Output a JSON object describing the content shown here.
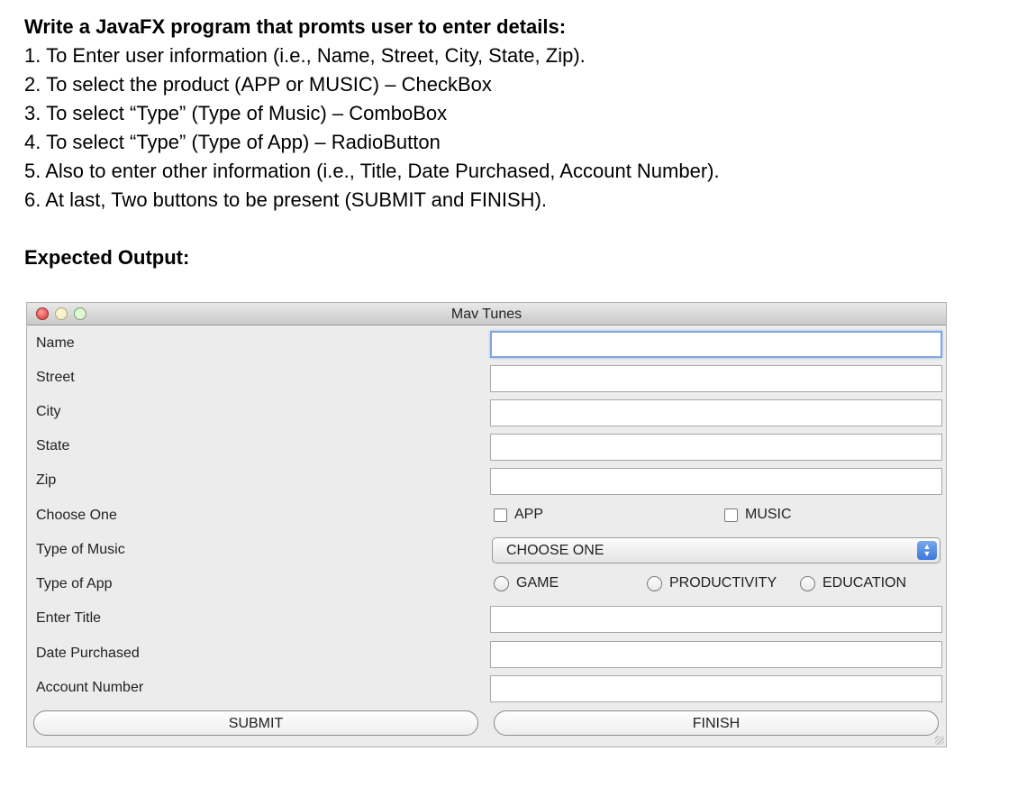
{
  "instructions": {
    "heading": "Write a JavaFX program that promts user to enter details:",
    "items": [
      "1. To Enter user information (i.e., Name, Street, City, State, Zip).",
      "2. To select the product (APP or MUSIC) – CheckBox",
      "3. To select “Type” (Type of Music) – ComboBox",
      "4. To select “Type” (Type of App) – RadioButton",
      "5. Also to enter other information (i.e., Title, Date Purchased, Account Number).",
      "6. At last, Two buttons to be present (SUBMIT and FINISH)."
    ],
    "expected_output": "Expected Output:"
  },
  "window": {
    "title": "Mav Tunes"
  },
  "form": {
    "name_label": "Name",
    "street_label": "Street",
    "city_label": "City",
    "state_label": "State",
    "zip_label": "Zip",
    "choose_one_label": "Choose One",
    "app_checkbox": "APP",
    "music_checkbox": "MUSIC",
    "type_of_music_label": "Type of Music",
    "music_combo_value": "CHOOSE ONE",
    "type_of_app_label": "Type of App",
    "radio_game": "GAME",
    "radio_productivity": "PRODUCTIVITY",
    "radio_education": "EDUCATION",
    "title_label": "Enter Title",
    "date_label": "Date Purchased",
    "account_label": "Account Number",
    "submit_button": "SUBMIT",
    "finish_button": "FINISH"
  }
}
